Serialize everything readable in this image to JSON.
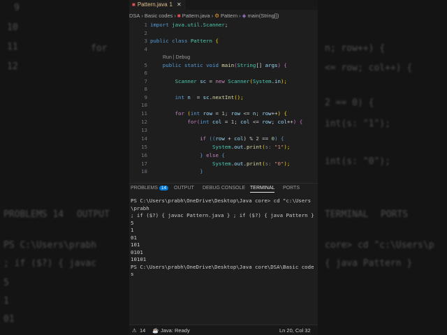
{
  "background": {
    "fragments": [
      "9",
      "10",
      "11",
      "12",
      "for",
      "n; row++) {",
      "<= row; col++) {",
      "2 == 0) {",
      "int(s: \"1\");",
      "int(s: \"0\");",
      "PROBLEMS 14",
      "OUTPUT",
      "TERMINAL",
      "PORTS",
      "PS C:\\Users\\prabh",
      "core> cd \"c:\\Users\\p",
      "; if ($?) { javac",
      "{ java Pattern }",
      "5",
      "1",
      "01"
    ]
  },
  "tab": {
    "label": "Pattern.java",
    "badge": "1"
  },
  "breadcrumb": [
    "DSA",
    "Basic codes",
    "Pattern.java",
    "Pattern",
    "main(String[])"
  ],
  "code_lens": "Run | Debug",
  "code": [
    {
      "n": "1",
      "tokens": [
        [
          "import ",
          "k"
        ],
        [
          "java.util.Scanner",
          "t"
        ],
        [
          ";",
          ""
        ]
      ]
    },
    {
      "n": "2",
      "tokens": []
    },
    {
      "n": "3",
      "tokens": [
        [
          "public class ",
          "k"
        ],
        [
          "Pattern ",
          "t"
        ],
        [
          "{",
          "y"
        ]
      ]
    },
    {
      "n": "4",
      "tokens": []
    },
    {
      "n": "5",
      "tokens": [
        [
          "    public static void ",
          "k"
        ],
        [
          "main",
          "f"
        ],
        [
          "(",
          "p"
        ],
        [
          "String",
          "t"
        ],
        [
          "[] ",
          ""
        ],
        [
          "args",
          "v"
        ],
        [
          ") {",
          "p"
        ]
      ]
    },
    {
      "n": "6",
      "tokens": []
    },
    {
      "n": "7",
      "tokens": [
        [
          "        Scanner ",
          "t"
        ],
        [
          "sc",
          "v"
        ],
        [
          " = ",
          ""
        ],
        [
          "new ",
          "c"
        ],
        [
          "Scanner",
          "t"
        ],
        [
          "(",
          "y"
        ],
        [
          "System",
          "t"
        ],
        [
          ".",
          ""
        ],
        [
          "in",
          "v"
        ],
        [
          ");",
          "y"
        ]
      ]
    },
    {
      "n": "8",
      "tokens": []
    },
    {
      "n": "9",
      "tokens": [
        [
          "        int ",
          "k"
        ],
        [
          "n",
          "v"
        ],
        [
          "  = ",
          ""
        ],
        [
          "sc",
          "v"
        ],
        [
          ".",
          ""
        ],
        [
          "nextInt",
          "f"
        ],
        [
          "();",
          "y"
        ]
      ]
    },
    {
      "n": "10",
      "tokens": []
    },
    {
      "n": "11",
      "tokens": [
        [
          "        for ",
          "c"
        ],
        [
          "(",
          "y"
        ],
        [
          "int ",
          "k"
        ],
        [
          "row",
          "v"
        ],
        [
          " = ",
          ""
        ],
        [
          "1",
          "n"
        ],
        [
          "; ",
          ""
        ],
        [
          "row",
          "v"
        ],
        [
          " <= ",
          ""
        ],
        [
          "n",
          "v"
        ],
        [
          "; ",
          ""
        ],
        [
          "row",
          "v"
        ],
        [
          "++",
          ""
        ],
        [
          ") {",
          "y"
        ]
      ]
    },
    {
      "n": "12",
      "tokens": [
        [
          "            for",
          "c"
        ],
        [
          "(",
          "p"
        ],
        [
          "int ",
          "k"
        ],
        [
          "col",
          "v"
        ],
        [
          " = ",
          ""
        ],
        [
          "1",
          "n"
        ],
        [
          "; ",
          ""
        ],
        [
          "col",
          "v"
        ],
        [
          " <= ",
          ""
        ],
        [
          "row",
          "v"
        ],
        [
          "; ",
          ""
        ],
        [
          "col",
          "v"
        ],
        [
          "++",
          ""
        ],
        [
          ") {",
          "p"
        ]
      ]
    },
    {
      "n": "13",
      "tokens": []
    },
    {
      "n": "14",
      "tokens": [
        [
          "                if ",
          "c"
        ],
        [
          "((",
          "k"
        ],
        [
          "row",
          "v"
        ],
        [
          " + ",
          ""
        ],
        [
          "col",
          "v"
        ],
        [
          ") % ",
          ""
        ],
        [
          "2",
          "n"
        ],
        [
          " == ",
          ""
        ],
        [
          "0",
          "n"
        ],
        [
          ") {",
          "k"
        ]
      ]
    },
    {
      "n": "15",
      "tokens": [
        [
          "                    System",
          "t"
        ],
        [
          ".",
          ""
        ],
        [
          "out",
          "v"
        ],
        [
          ".",
          ""
        ],
        [
          "print",
          "f"
        ],
        [
          "(",
          "y"
        ],
        [
          "s: ",
          "h"
        ],
        [
          "\"1\"",
          "s"
        ],
        [
          ");",
          "y"
        ]
      ]
    },
    {
      "n": "16",
      "tokens": [
        [
          "                } ",
          "k"
        ],
        [
          "else ",
          "c"
        ],
        [
          "{",
          "k"
        ]
      ]
    },
    {
      "n": "17",
      "tokens": [
        [
          "                    System",
          "t"
        ],
        [
          ".",
          ""
        ],
        [
          "out",
          "v"
        ],
        [
          ".",
          ""
        ],
        [
          "print",
          "f"
        ],
        [
          "(",
          "y"
        ],
        [
          "s: ",
          "h"
        ],
        [
          "\"0\"",
          "s"
        ],
        [
          ");",
          "y"
        ]
      ]
    },
    {
      "n": "18",
      "tokens": [
        [
          "                }",
          "k"
        ]
      ]
    }
  ],
  "panel_tabs": {
    "problems": "PROBLEMS",
    "problems_count": "14",
    "output": "OUTPUT",
    "debug": "DEBUG CONSOLE",
    "terminal": "TERMINAL",
    "ports": "PORTS"
  },
  "terminal": [
    "PS C:\\Users\\prabh\\OneDrive\\Desktop\\Java core> cd \"c:\\Users\\prabh",
    "; if ($?) { javac Pattern.java } ; if ($?) { java Pattern }",
    "5",
    "1",
    "01",
    "101",
    "0101",
    "10101",
    "PS C:\\Users\\prabh\\OneDrive\\Desktop\\Java core\\DSA\\Basic codes"
  ],
  "status": {
    "warnings": "14",
    "java": "Java: Ready",
    "position": "Ln 20, Col 32"
  }
}
